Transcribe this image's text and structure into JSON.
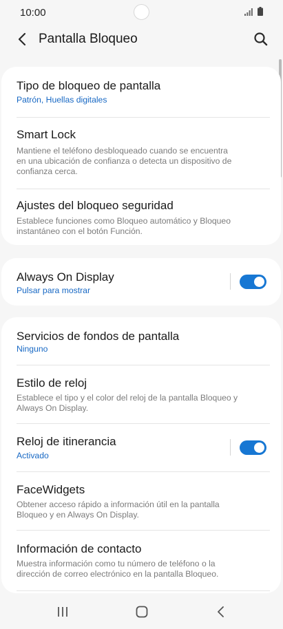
{
  "status_bar": {
    "time": "10:00"
  },
  "header": {
    "title": "Pantalla Bloqueo"
  },
  "group1": {
    "screen_lock_type": {
      "title": "Tipo de bloqueo de pantalla",
      "value": "Patrón, Huellas digitales"
    },
    "smart_lock": {
      "title": "Smart Lock",
      "line1": "Mantiene el teléfono desbloqueado cuando se encuentra",
      "line2": "en una ubicación de confianza o detecta un dispositivo de",
      "line3": "confianza cerca."
    },
    "secure_lock_settings": {
      "title": "Ajustes del bloqueo seguridad",
      "line1": "Establece funciones como Bloqueo automático y Bloqueo",
      "line2": "instantáneo con el botón Función."
    }
  },
  "group2": {
    "always_on_display": {
      "title": "Always On Display",
      "value": "Pulsar para mostrar",
      "enabled": true
    }
  },
  "group3": {
    "wallpaper_services": {
      "title": "Servicios de fondos de pantalla",
      "value": "Ninguno"
    },
    "clock_style": {
      "title": "Estilo de reloj",
      "line1": "Establece el tipo y el color del reloj de la pantalla Bloqueo y",
      "line2": "Always On Display."
    },
    "roaming_clock": {
      "title": "Reloj de itinerancia",
      "value": "Activado",
      "enabled": true
    },
    "facewidgets": {
      "title": "FaceWidgets",
      "line1": "Obtener acceso rápido a información útil en la pantalla",
      "line2": "Bloqueo y en Always On Display."
    },
    "contact_info": {
      "title": "Información de contacto",
      "line1": "Muestra información como tu número de teléfono o la",
      "line2": "dirección de correo electrónico en la pantalla Bloqueo."
    }
  },
  "colors": {
    "accent": "#1777d3",
    "link_text": "#1768c4",
    "background": "#f6f6f6",
    "card": "#ffffff"
  },
  "nav_bar": {
    "icons": [
      "recent-apps-icon",
      "home-icon",
      "back-icon"
    ]
  }
}
